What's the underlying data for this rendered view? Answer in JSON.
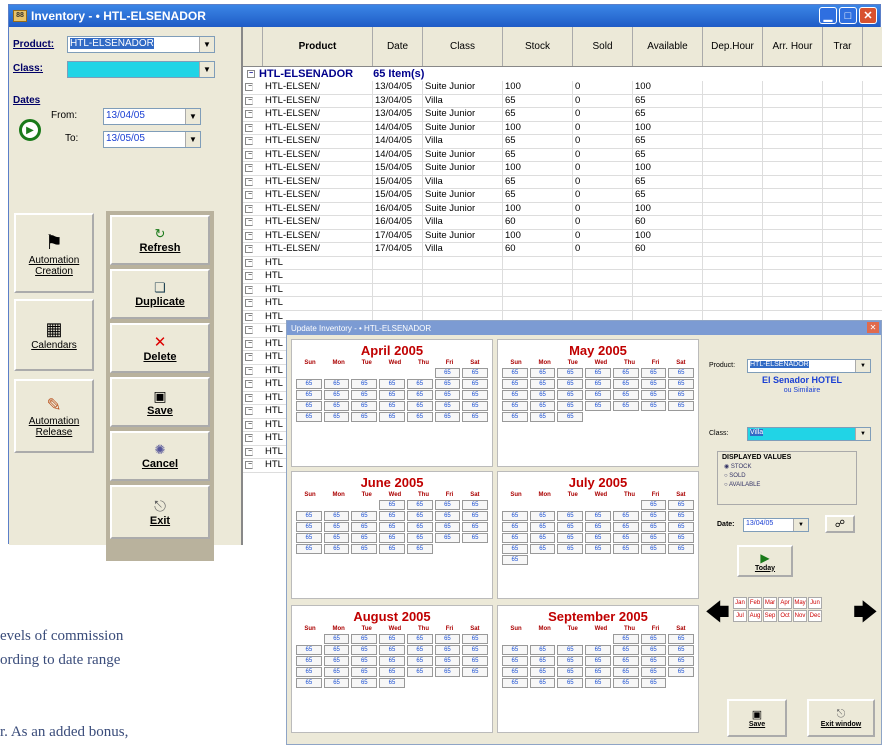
{
  "inventory_window": {
    "title": "Inventory  - • HTL-ELSENADOR",
    "min": "▁",
    "max": "□",
    "close": "✕",
    "product_label": "Product:",
    "product_value": "HTL-ELSENADOR",
    "class_label": "Class:",
    "class_value": "",
    "dates_label": "Dates",
    "from_label": "From:",
    "from_value": "13/04/05",
    "to_label": "To:",
    "to_value": "13/05/05",
    "automation_creation": "Automation Creation",
    "calendars": "Calendars",
    "automation_release": "Automation Release",
    "refresh": "Refresh",
    "duplicate": "Duplicate",
    "delete": "Delete",
    "save": "Save",
    "cancel": "Cancel",
    "exit": "Exit",
    "columns": [
      "Product",
      "Date",
      "Class",
      "Stock",
      "Sold",
      "Available",
      "Dep.Hour",
      "Arr. Hour",
      "Trar"
    ],
    "group_name": "HTL-ELSENADOR",
    "group_count": "65 Item(s)",
    "rows": [
      [
        "HTL-ELSEN/",
        "13/04/05",
        "Suite Junior",
        "100",
        "0",
        "100"
      ],
      [
        "HTL-ELSEN/",
        "13/04/05",
        "Villa",
        "65",
        "0",
        "65"
      ],
      [
        "HTL-ELSEN/",
        "13/04/05",
        "Suite Junior",
        "65",
        "0",
        "65"
      ],
      [
        "HTL-ELSEN/",
        "14/04/05",
        "Suite Junior",
        "100",
        "0",
        "100"
      ],
      [
        "HTL-ELSEN/",
        "14/04/05",
        "Villa",
        "65",
        "0",
        "65"
      ],
      [
        "HTL-ELSEN/",
        "14/04/05",
        "Suite Junior",
        "65",
        "0",
        "65"
      ],
      [
        "HTL-ELSEN/",
        "15/04/05",
        "Suite Junior",
        "100",
        "0",
        "100"
      ],
      [
        "HTL-ELSEN/",
        "15/04/05",
        "Villa",
        "65",
        "0",
        "65"
      ],
      [
        "HTL-ELSEN/",
        "15/04/05",
        "Suite Junior",
        "65",
        "0",
        "65"
      ],
      [
        "HTL-ELSEN/",
        "16/04/05",
        "Suite Junior",
        "100",
        "0",
        "100"
      ],
      [
        "HTL-ELSEN/",
        "16/04/05",
        "Villa",
        "60",
        "0",
        "60"
      ],
      [
        "HTL-ELSEN/",
        "17/04/05",
        "Suite Junior",
        "100",
        "0",
        "100"
      ],
      [
        "HTL-ELSEN/",
        "17/04/05",
        "Villa",
        "60",
        "0",
        "60"
      ],
      [
        "HTL",
        "",
        "",
        "",
        "",
        ""
      ],
      [
        "HTL",
        "",
        "",
        "",
        "",
        ""
      ],
      [
        "HTL",
        "",
        "",
        "",
        "",
        ""
      ],
      [
        "HTL",
        "",
        "",
        "",
        "",
        ""
      ],
      [
        "HTL",
        "",
        "",
        "",
        "",
        ""
      ],
      [
        "HTL",
        "",
        "",
        "",
        "",
        ""
      ],
      [
        "HTL",
        "",
        "",
        "",
        "",
        ""
      ],
      [
        "HTL",
        "",
        "",
        "",
        "",
        ""
      ],
      [
        "HTL",
        "",
        "",
        "",
        "",
        ""
      ],
      [
        "HTL",
        "",
        "",
        "",
        "",
        ""
      ],
      [
        "HTL",
        "",
        "",
        "",
        "",
        ""
      ],
      [
        "HTL",
        "",
        "",
        "",
        "",
        ""
      ],
      [
        "HTL",
        "",
        "",
        "",
        "",
        ""
      ],
      [
        "HTL",
        "",
        "",
        "",
        "",
        ""
      ],
      [
        "HTL",
        "",
        "",
        "",
        "",
        ""
      ],
      [
        "HTL",
        "",
        "",
        "",
        "",
        ""
      ]
    ]
  },
  "update_window": {
    "title": "Update Inventory   - • HTL-ELSENADOR",
    "close": "✕",
    "months": [
      {
        "name": "April 2005",
        "color": "#c00000",
        "offset": 5,
        "days": 30
      },
      {
        "name": "May 2005",
        "color": "#c00000",
        "offset": 0,
        "days": 31
      },
      {
        "name": "June 2005",
        "color": "#c00000",
        "offset": 3,
        "days": 30
      },
      {
        "name": "July 2005",
        "color": "#c00000",
        "offset": 5,
        "days": 31
      },
      {
        "name": "August 2005",
        "color": "#c00000",
        "offset": 1,
        "days": 31
      },
      {
        "name": "September 2005",
        "color": "#c00000",
        "offset": 4,
        "days": 30
      }
    ],
    "weekdays": [
      "Sun",
      "Mon",
      "Tue",
      "Wed",
      "Thu",
      "Fri",
      "Sat"
    ],
    "product_label": "Product:",
    "product_value": "HTL-ELSENADOR",
    "hotel_name": "El Senador HOTEL",
    "hotel_sub": "ou Similaire",
    "class_label": "Class:",
    "class_value": "Villa",
    "displayed_values": "DISPLAYED VALUES",
    "opt_stock": "STOCK",
    "opt_sold": "SOLD",
    "opt_available": "AVAILABLE",
    "date_label": "Date:",
    "date_value": "13/04/05",
    "today": "Today",
    "months_short": [
      "Jan",
      "Feb",
      "Mar",
      "Apr",
      "May",
      "Jun",
      "Jul",
      "Aug",
      "Sep",
      "Oct",
      "Nov",
      "Dec"
    ],
    "save": "Save",
    "exit_window": "Exit window"
  },
  "prose": {
    "line1": "evels of commission",
    "line2": "ording to date range",
    "line3": "r. As an added bonus,"
  }
}
